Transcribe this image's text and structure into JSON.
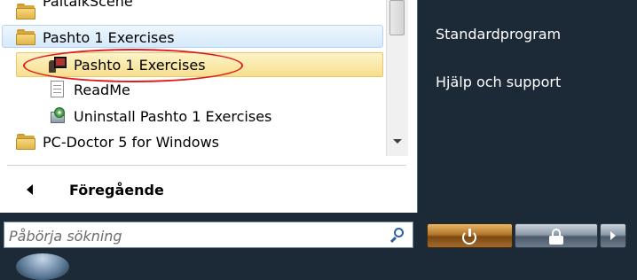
{
  "programs": {
    "items": [
      {
        "label": "PaltalkScene",
        "icon": "folder-icon"
      },
      {
        "label": "Pashto 1 Exercises",
        "icon": "folder-icon"
      },
      {
        "label": "Pashto 1 Exercises",
        "icon": "app-icon"
      },
      {
        "label": "ReadMe",
        "icon": "document-icon"
      },
      {
        "label": "Uninstall Pashto 1 Exercises",
        "icon": "uninstall-icon"
      },
      {
        "label": "PC-Doctor 5 for Windows",
        "icon": "folder-icon"
      }
    ],
    "back_label": "Föregående"
  },
  "search": {
    "placeholder": "Påbörja sökning"
  },
  "right_panel": {
    "links": [
      "Standardprogram",
      "Hjälp och support"
    ]
  },
  "colors": {
    "highlight": "#f7df8e",
    "annotation": "#e11a1a",
    "panel_bg": "#1c2a38"
  }
}
